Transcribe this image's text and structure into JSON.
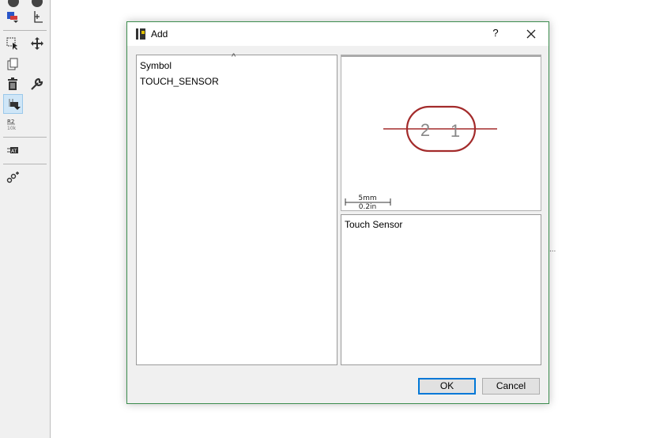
{
  "dialog": {
    "title": "Add",
    "help_label": "?",
    "list_header": "Symbol",
    "list_items": [
      "TOUCH_SENSOR"
    ],
    "preview": {
      "pin_labels": [
        "2",
        "1"
      ],
      "scale_metric": "5mm",
      "scale_imperial": "0.2in"
    },
    "description": "Touch Sensor",
    "ok_label": "OK",
    "cancel_label": "Cancel"
  },
  "stray_text": "...",
  "colors": {
    "dialog_border": "#3c8d4e",
    "symbol_outline": "#a32b2b",
    "ok_focus": "#0078d7"
  },
  "toolbar": {
    "icons": [
      "info-icon",
      "layer-icon",
      "color-icon",
      "origin-icon",
      "select-icon",
      "move-icon",
      "copy-icon",
      "delete-icon",
      "wrench-icon",
      "add-part-icon",
      "value-icon",
      "attribute-icon",
      "net-icon"
    ]
  }
}
